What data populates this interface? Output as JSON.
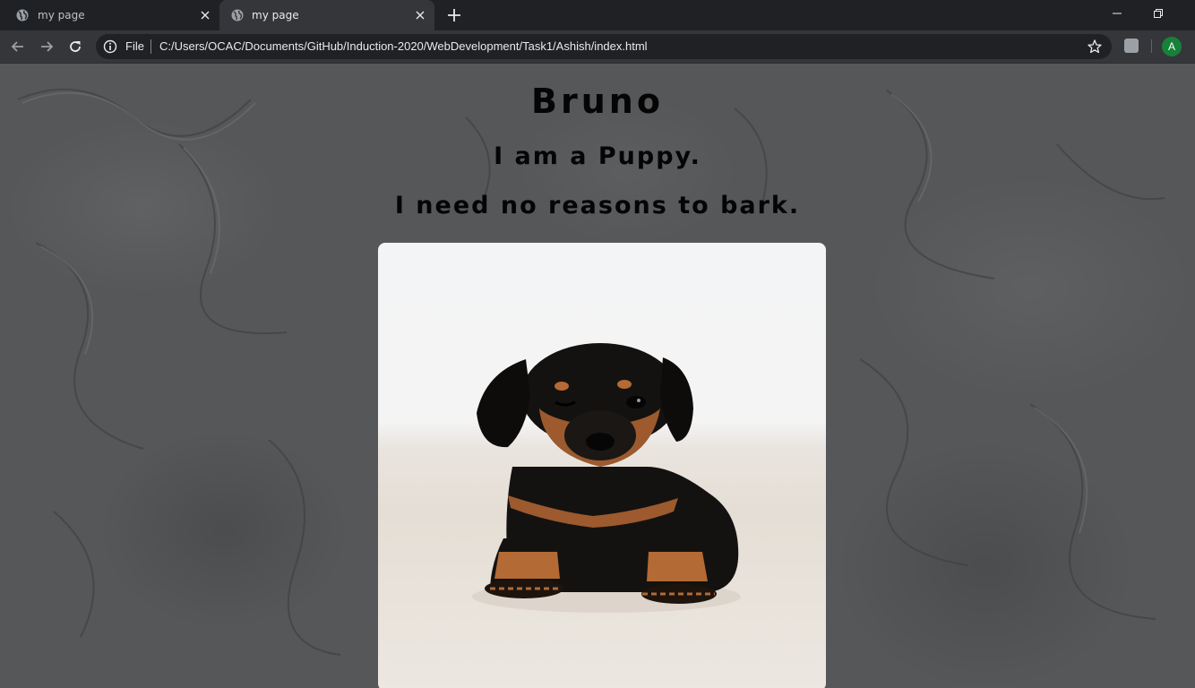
{
  "browser": {
    "tabs": [
      {
        "title": "my page",
        "active": false
      },
      {
        "title": "my page",
        "active": true
      }
    ],
    "address": {
      "scheme_label": "File",
      "url": "C:/Users/OCAC/Documents/GitHub/Induction-2020/WebDevelopment/Task1/Ashish/index.html"
    },
    "profile_initial": "A",
    "colors": {
      "frame": "#202124",
      "toolbar": "#35363a",
      "avatar": "#188038"
    }
  },
  "page": {
    "name": "Bruno",
    "line1": "I am a Puppy.",
    "line2": "I need no reasons to bark.",
    "colors": {
      "background": "#555759",
      "text": "#050505"
    }
  }
}
